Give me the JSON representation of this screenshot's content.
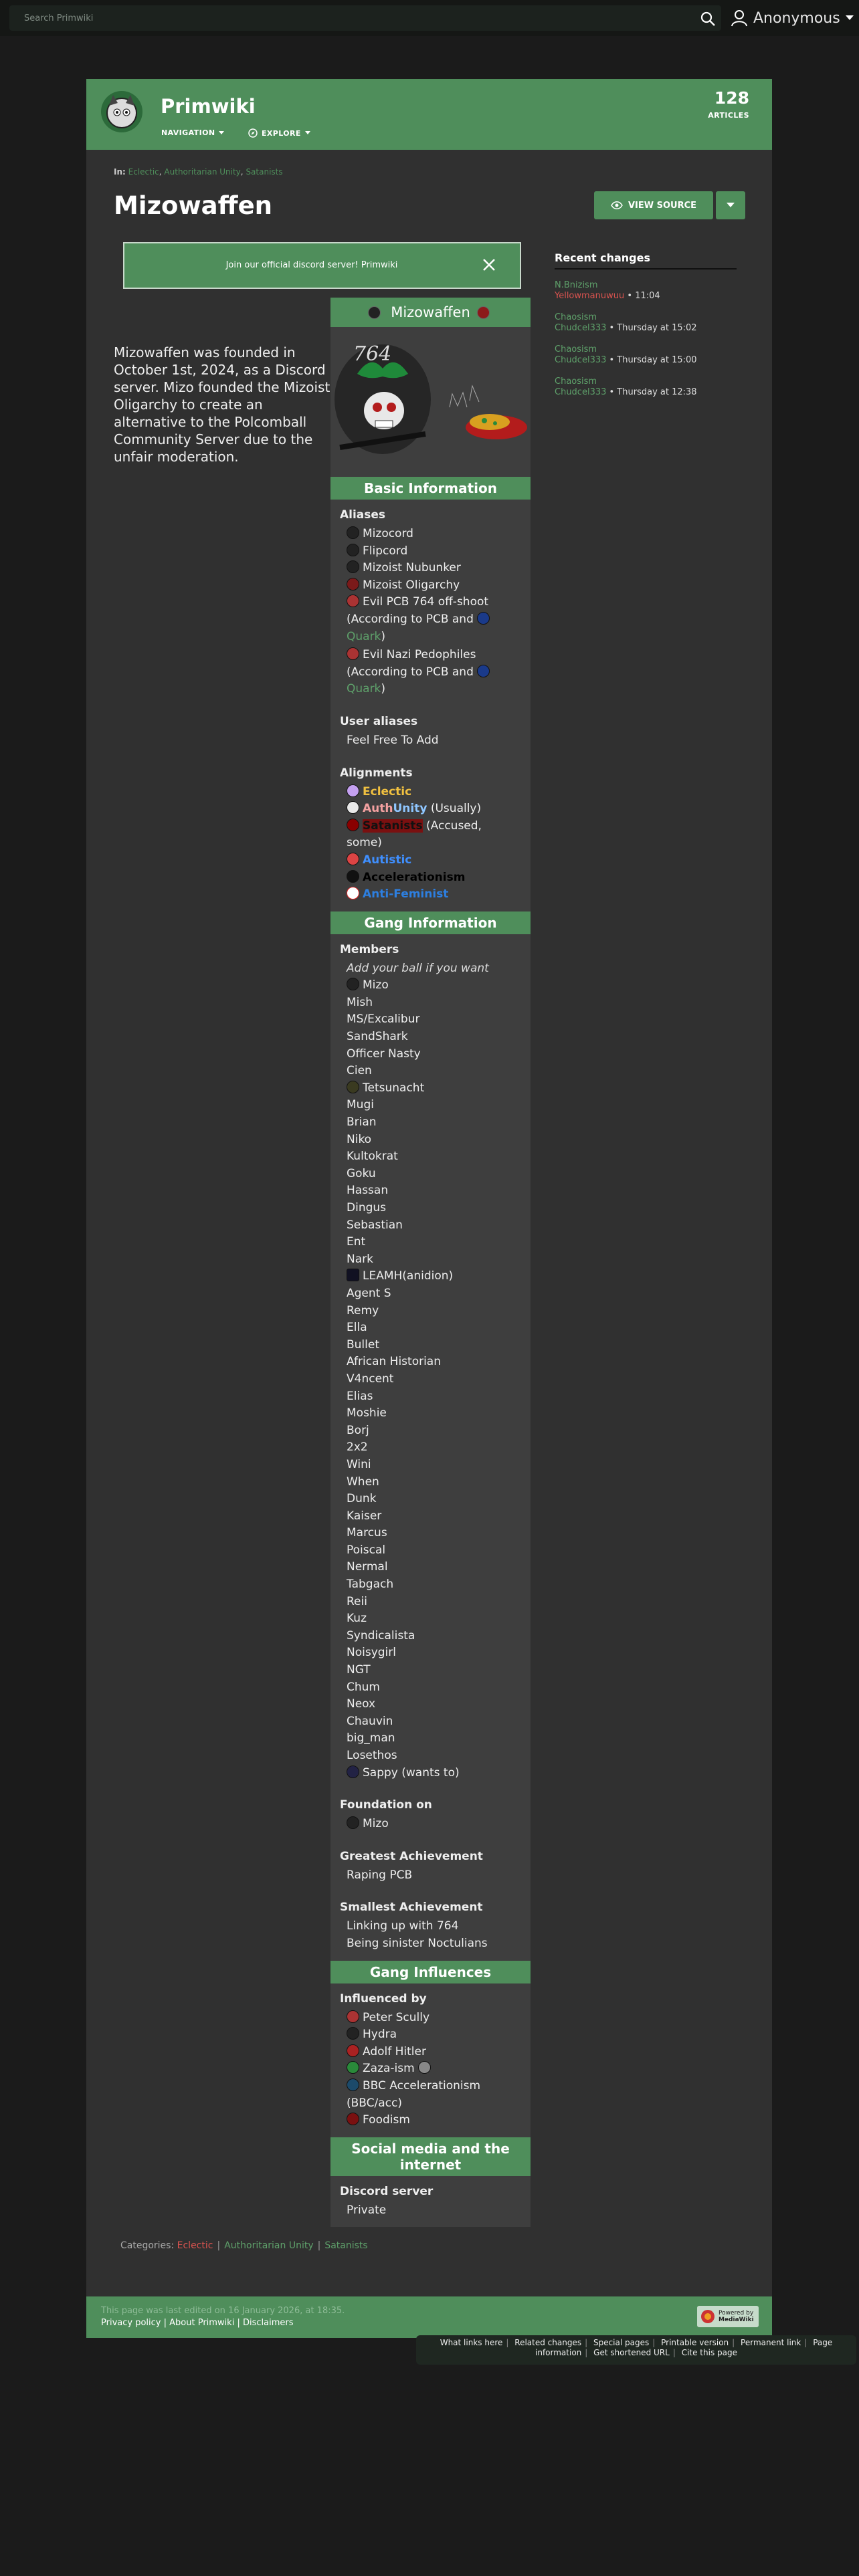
{
  "search": {
    "placeholder": "Search Primwiki"
  },
  "user": {
    "label": "Anonymous"
  },
  "wiki": {
    "title": "Primwiki",
    "nav_label": "NAVIGATION",
    "explore_label": "EXPLORE",
    "article_count": "128",
    "article_count_label": "ARTICLES"
  },
  "breadcrumb": {
    "prefix": "In:",
    "items": [
      "Eclectic",
      "Authoritarian Unity",
      "Satanists"
    ]
  },
  "page": {
    "title": "Mizowaffen",
    "view_source": "VIEW SOURCE"
  },
  "notice": {
    "text": "Join our official discord server! Primwiki"
  },
  "intro": "Mizowaffen was founded in October 1st, 2024, as a Discord server. Mizo founded the Mizoist Oligarchy to create an alternative to the Polcomball Community Server due to the unfair moderation.",
  "recent_changes": {
    "title": "Recent changes",
    "items": [
      {
        "page": "N.Bnizism",
        "user": "Yellowmanuwuu",
        "time": "11:04"
      },
      {
        "page": "Chaosism",
        "user": "Chudcel333",
        "time": "Thursday at 15:02"
      },
      {
        "page": "Chaosism",
        "user": "Chudcel333",
        "time": "Thursday at 15:00"
      },
      {
        "page": "Chaosism",
        "user": "Chudcel333",
        "time": "Thursday at 12:38"
      }
    ]
  },
  "infobox": {
    "title": "Mizowaffen",
    "image_text": "764",
    "basic_info_title": "Basic Information",
    "aliases_label": "Aliases",
    "aliases": [
      "Mizocord",
      "Flipcord",
      "Mizoist Nubunker",
      "Mizoist Oligarchy"
    ],
    "alias_764_a": "Evil PCB 764 off-shoot",
    "alias_764_b": "(According to PCB and",
    "alias_764_c": "Quark",
    "alias_764_d": ")",
    "alias_nazi_a": "Evil Nazi Pedophiles",
    "alias_nazi_b": "(According to PCB and",
    "alias_nazi_c": "Quark",
    "alias_nazi_d": ")",
    "user_aliases_label": "User aliases",
    "user_aliases": "Feel Free To Add",
    "alignments_label": "Alignments",
    "alignment_eclectic": "Eclectic",
    "alignment_auth_a": "Auth",
    "alignment_auth_b": "Unity",
    "alignment_auth_note": "(Usually)",
    "alignment_satanists": "Satanists",
    "alignment_satanists_note_a": "(Accused,",
    "alignment_satanists_note_b": "some)",
    "alignment_autistic": "Autistic",
    "alignment_accel": "Accelerationism",
    "alignment_antifem": "Anti-Feminist",
    "gang_info_title": "Gang Information",
    "members_label": "Members",
    "members_note": "Add your ball if you want",
    "member_mizo": "Mizo",
    "members_a": [
      "Mish",
      "MS/Excalibur",
      "SandShark",
      "Officer Nasty",
      "Cien"
    ],
    "member_tetsunacht": "Tetsunacht",
    "members_b": [
      "Mugi",
      "Brian",
      "Niko",
      "Kultokrat",
      "Goku",
      "Hassan",
      "Dingus",
      "Sebastian",
      "Ent",
      "Nark"
    ],
    "member_leamh": "LEAMH(anidion)",
    "members_c": [
      "Agent S",
      "Remy",
      "Ella",
      "Bullet",
      "African Historian",
      "V4ncent",
      "Elias",
      "Moshie",
      "Borj",
      "2x2",
      "Wini",
      "When",
      "Dunk",
      "Kaiser",
      "Marcus",
      "Poiscal",
      "Nermal",
      "Tabgach",
      "Reii",
      "Kuz",
      "Syndicalista",
      "Noisygirl",
      "NGT",
      "Chum",
      "Neox",
      "Chauvin",
      "big_man",
      "Losethos"
    ],
    "member_sappy": "Sappy (wants to)",
    "foundation_label": "Foundation on",
    "foundation": "Mizo",
    "greatest_label": "Greatest Achievement",
    "greatest": "Raping PCB",
    "smallest_label": "Smallest Achievement",
    "smallest": [
      "Linking up with 764",
      "Being sinister Noctulians"
    ],
    "influences_title": "Gang Influences",
    "influenced_label": "Influenced by",
    "influences": [
      "Peter Scully",
      "Hydra",
      "Adolf Hitler",
      "Zaza-ism",
      "BBC Accelerationism",
      "(BBC/acc)",
      "Foodism"
    ],
    "social_title": "Social media and the internet",
    "discord_label": "Discord server",
    "discord": "Private"
  },
  "categories": {
    "label": "Categories:",
    "items": [
      "Eclectic",
      "Authoritarian Unity",
      "Satanists"
    ]
  },
  "footer": {
    "edited": "This page was last edited on 16 January 2026, at 18:35.",
    "links": [
      "Privacy policy",
      "About Primwiki",
      "Disclaimers"
    ],
    "powered_a": "Powered by",
    "powered_b": "MediaWiki"
  },
  "tools": {
    "line1": [
      "What links here",
      "Related changes",
      "Special pages",
      "Printable version",
      "Permanent link",
      "Page"
    ],
    "line2": [
      "information",
      "Get shortened URL",
      "Cite this page"
    ]
  },
  "colors": {
    "accent": "#4f8e5b",
    "page_bg": "#303030",
    "body_bg": "#1b1b1b",
    "link": "#5ea06a",
    "redlink": "#d9534f"
  }
}
